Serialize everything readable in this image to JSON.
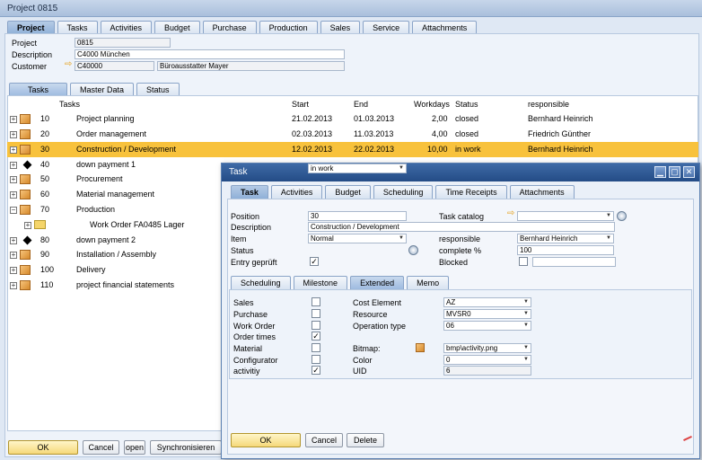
{
  "window": {
    "title": "Project 0815"
  },
  "main_tabs": [
    "Project",
    "Tasks",
    "Activities",
    "Budget",
    "Purchase",
    "Production",
    "Sales",
    "Service",
    "Attachments"
  ],
  "header": {
    "project_label": "Project",
    "project_value": "0815",
    "description_label": "Description",
    "description_value": "C4000 München",
    "customer_label": "Customer",
    "customer_code": "C40000",
    "customer_name": "Büroausstatter Mayer"
  },
  "sub_tabs": [
    "Tasks",
    "Master Data",
    "Status"
  ],
  "grid": {
    "columns": {
      "tasks": "Tasks",
      "start": "Start",
      "end": "End",
      "workdays": "Workdays",
      "status": "Status",
      "responsible": "responsible"
    },
    "rows": [
      {
        "num": "10",
        "name": "Project planning",
        "start": "21.02.2013",
        "end": "01.03.2013",
        "workdays": "2,00",
        "status": "closed",
        "responsible": "Bernhard Heinrich",
        "icon": "cube-icon"
      },
      {
        "num": "20",
        "name": "Order management",
        "start": "02.03.2013",
        "end": "11.03.2013",
        "workdays": "4,00",
        "status": "closed",
        "responsible": "Friedrich Günther",
        "icon": "cube-icon"
      },
      {
        "num": "30",
        "name": "Construction / Development",
        "start": "12.02.2013",
        "end": "22.02.2013",
        "workdays": "10,00",
        "status": "in work",
        "responsible": "Bernhard Heinrich",
        "icon": "cube-icon",
        "selected": true
      },
      {
        "num": "40",
        "name": "down payment 1",
        "icon": "milestone-icon"
      },
      {
        "num": "50",
        "name": "Procurement",
        "icon": "cube-icon"
      },
      {
        "num": "60",
        "name": "Material management",
        "icon": "cube-icon"
      },
      {
        "num": "70",
        "name": "Production",
        "icon": "cube-icon",
        "expanded": true
      },
      {
        "num": "",
        "name": "Work Order FA0485 Lager",
        "icon": "folder-icon",
        "child": true
      },
      {
        "num": "80",
        "name": "down payment 2",
        "icon": "milestone-icon"
      },
      {
        "num": "90",
        "name": "Installation / Assembly",
        "icon": "cube-icon"
      },
      {
        "num": "100",
        "name": "Delivery",
        "icon": "cube-icon"
      },
      {
        "num": "110",
        "name": "project financial statements",
        "icon": "cube-icon"
      }
    ]
  },
  "bottom_buttons": {
    "ok": "OK",
    "cancel": "Cancel",
    "open": "open",
    "sync": "Synchronisieren"
  },
  "dialog": {
    "title": "Task",
    "tabs": [
      "Task",
      "Activities",
      "Budget",
      "Scheduling",
      "Time Receipts",
      "Attachments"
    ],
    "position_label": "Position",
    "position_value": "30",
    "task_catalog_label": "Task catalog",
    "task_catalog_value": "",
    "description_label": "Description",
    "description_value": "Construction / Development",
    "item_label": "Item",
    "item_value": "Normal",
    "responsible_label": "responsible",
    "responsible_value": "Bernhard Heinrich",
    "status_label": "Status",
    "status_value": "in work",
    "complete_label": "complete %",
    "complete_value": "100",
    "entry_label": "Entry geprüft",
    "entry_checked": true,
    "blocked_label": "Blocked",
    "blocked_checked": false,
    "blocked_value": "",
    "inner_tabs": [
      "Scheduling",
      "Milestone",
      "Extended",
      "Memo"
    ],
    "extended": {
      "checks": [
        {
          "label": "Sales",
          "checked": false
        },
        {
          "label": "Purchase",
          "checked": false
        },
        {
          "label": "Work Order",
          "checked": false
        },
        {
          "label": "Order times",
          "checked": true
        },
        {
          "label": "Material",
          "checked": false
        },
        {
          "label": "Configurator",
          "checked": false
        },
        {
          "label": "activitiy",
          "checked": true
        }
      ],
      "cost_element_label": "Cost Element",
      "cost_element_value": "AZ",
      "resource_label": "Resource",
      "resource_value": "MVSR0",
      "operation_type_label": "Operation type",
      "operation_type_value": "06",
      "bitmap_label": "Bitmap:",
      "bitmap_value": "bmp\\activity.png",
      "color_label": "Color",
      "color_value": "0",
      "uid_label": "UID",
      "uid_value": "6"
    },
    "buttons": {
      "ok": "OK",
      "cancel": "Cancel",
      "delete": "Delete"
    },
    "window_controls": [
      "minimize-icon",
      "maximize-icon",
      "close-icon"
    ]
  },
  "colors": {
    "selection": "#f8c23c",
    "title_bar": "#2f5a96",
    "accent_orange": "#e6a11b"
  }
}
